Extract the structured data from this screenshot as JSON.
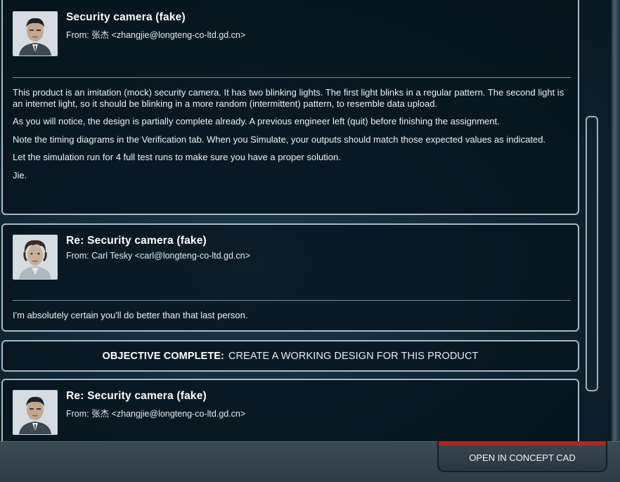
{
  "messages": [
    {
      "subject": "Security camera (fake)",
      "from": "From: 张杰 <zhangjie@longteng-co-ltd.gd.cn>",
      "avatar": "avatar-zhangjie",
      "paragraphs": [
        "This product is an imitation (mock) security camera. It has two blinking lights. The first light blinks in a regular pattern. The second light is an internet light, so it should be blinking in a more random (intermittent) pattern, to resemble data upload.",
        "As you will notice, the design is partially complete already. A previous engineer left (quit) before finishing the assignment.",
        "Note the timing diagrams in the Verification tab. When you Simulate, your outputs should match those expected values as indicated.",
        "Let the simulation run for 4 full test runs to make sure you have a proper solution.",
        "Jie."
      ]
    },
    {
      "subject": "Re: Security camera (fake)",
      "from": "From: Carl Tesky <carl@longteng-co-ltd.gd.cn>",
      "avatar": "avatar-carl",
      "paragraphs": [
        "I'm absolutely certain you'll do better than that last person."
      ]
    },
    {
      "subject": "Re: Security camera (fake)",
      "from": "From: 张杰 <zhangjie@longteng-co-ltd.gd.cn>",
      "avatar": "avatar-zhangjie"
    }
  ],
  "objective": {
    "label": "OBJECTIVE COMPLETE:",
    "text": "CREATE A WORKING DESIGN FOR THIS PRODUCT"
  },
  "actions": {
    "open_button": "OPEN IN CONCEPT CAD"
  },
  "colors": {
    "accent_red": "#b3261e",
    "panel_border": "#a9bcc8",
    "background": "#0f2330"
  }
}
